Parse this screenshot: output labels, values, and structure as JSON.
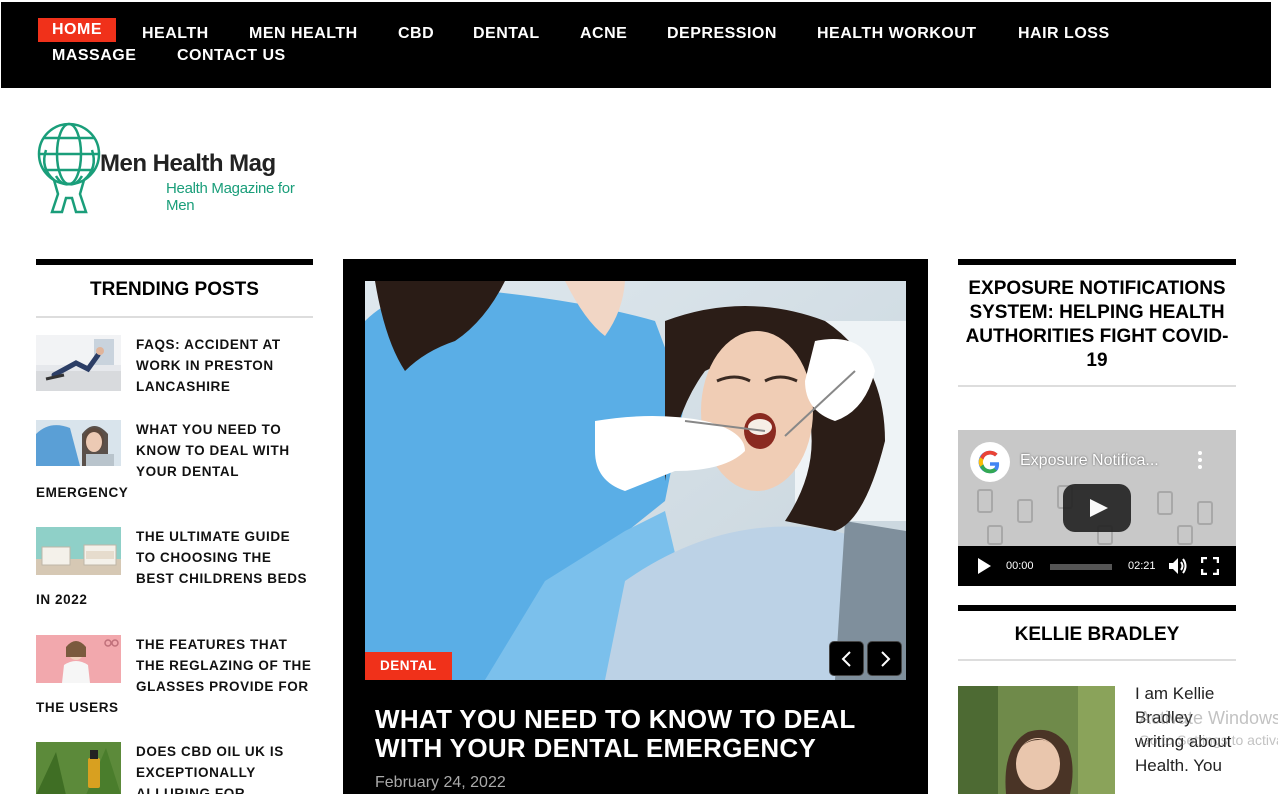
{
  "nav": {
    "items": [
      "HOME",
      "HEALTH",
      "MEN HEALTH",
      "CBD",
      "DENTAL",
      "ACNE",
      "DEPRESSION",
      "HEALTH WORKOUT",
      "HAIR LOSS",
      "MASSAGE",
      "CONTACT US"
    ],
    "active": "HOME",
    "accent_color": "#f0311a"
  },
  "logo": {
    "title": "Men Health Mag",
    "tagline": "Health Magazine for Men",
    "icon": "man-lifting-globe-icon"
  },
  "trending": {
    "title": "TRENDING POSTS",
    "items": [
      "FAQS: ACCIDENT AT WORK IN PRESTON LANCASHIRE",
      "WHAT YOU NEED TO KNOW TO DEAL WITH YOUR DENTAL EMERGENCY",
      "THE ULTIMATE GUIDE TO CHOOSING THE BEST CHILDRENS BEDS IN 2022",
      "THE FEATURES THAT THE REGLAZING OF THE GLASSES PROVIDE FOR THE USERS",
      "DOES CBD OIL UK IS EXCEPTIONALLY ALLURING FOR"
    ]
  },
  "feature": {
    "category": "DENTAL",
    "title": "WHAT YOU NEED TO KNOW TO DEAL WITH YOUR DENTAL EMERGENCY",
    "date": "February 24, 2022",
    "prev_icon": "chevron-left-icon",
    "next_icon": "chevron-right-icon"
  },
  "exposure": {
    "title": "EXPOSURE NOTIFICATIONS SYSTEM: HELPING HEALTH AUTHORITIES FIGHT COVID-19",
    "video_title": "Exposure Notifica...",
    "time_current": "00:00",
    "time_total": "02:21"
  },
  "author": {
    "title": "KELLIE BRADLEY",
    "bio": "I am Kellie Bradley writing about Health. You"
  },
  "os_watermark": {
    "line1": "Activate Windows",
    "line2": "Go to Settings to activate Windows."
  }
}
